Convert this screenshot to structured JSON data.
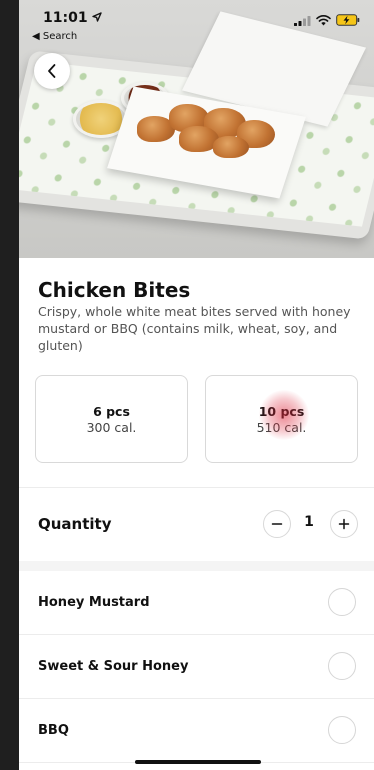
{
  "status_bar": {
    "time": "11:01",
    "back_app": "Search"
  },
  "product": {
    "name": "Chicken Bites",
    "description": "Crispy, whole white meat bites served with honey mustard or BBQ (contains milk, wheat, soy, and gluten)"
  },
  "sizes": [
    {
      "pcs": "6 pcs",
      "cal": "300 cal."
    },
    {
      "pcs": "10 pcs",
      "cal": "510 cal."
    }
  ],
  "quantity": {
    "label": "Quantity",
    "value": "1"
  },
  "sauces": [
    {
      "label": "Honey Mustard"
    },
    {
      "label": "Sweet & Sour Honey"
    },
    {
      "label": "BBQ"
    }
  ],
  "icons": {
    "back": "chevron-left-icon",
    "location": "location-arrow-icon",
    "signal": "signal-icon",
    "wifi": "wifi-icon",
    "battery": "battery-charging-icon",
    "minus": "minus-icon",
    "plus": "plus-icon"
  },
  "colors": {
    "battery": "#f5c518",
    "tap_highlight": "#dc283c"
  }
}
